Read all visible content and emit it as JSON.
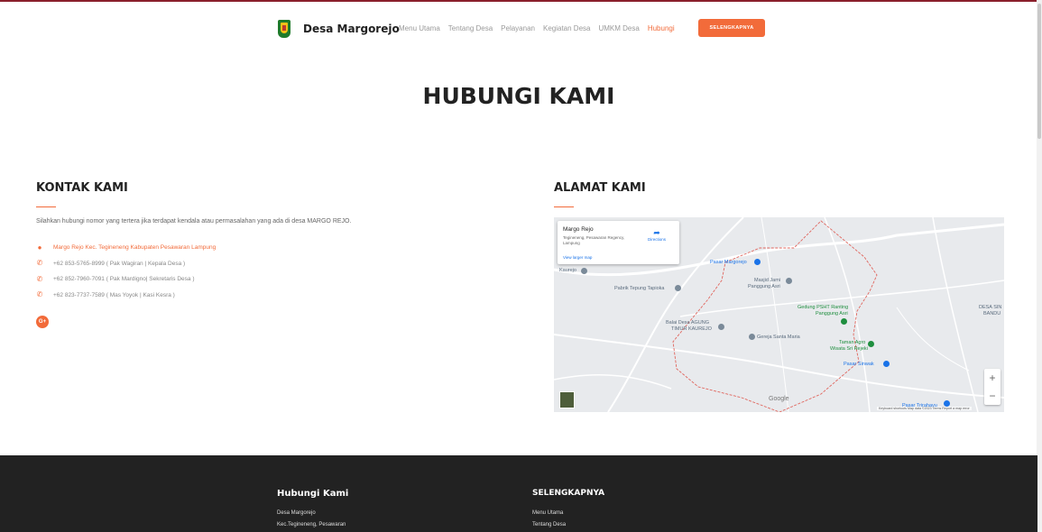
{
  "brand": {
    "name": "Desa Margorejo"
  },
  "nav": {
    "items": [
      "Menu Utama",
      "Tentang Desa",
      "Pelayanan",
      "Kegiatan Desa",
      "UMKM Desa",
      "Hubungi"
    ],
    "active": "Hubungi",
    "cta": "SELENGKAPNYA"
  },
  "hero": {
    "title": "HUBUNGI KAMI"
  },
  "contact": {
    "heading": "KONTAK KAMI",
    "intro": "Silahkan hubungi nomor yang tertera jika terdapat kendala atau permasalahan yang ada di desa MARGO REJO.",
    "address": "Margo Rejo Kec. Tegineneng Kabupaten Pesawaran Lampung",
    "phones": [
      "+62 853-5765-8999 ( Pak Wagiran | Kepala Desa )",
      "+62 852-7960-7091 ( Pak Mardigno| Sekretaris Desa )",
      "+62 823-7737-7589 ( Mas Yoyok | Kasi Kesra )"
    ],
    "social_icon": "google-plus-icon",
    "social_label": "G+"
  },
  "address_section": {
    "heading": "ALAMAT KAMI",
    "map": {
      "card_title": "Margo Rejo",
      "card_subtitle": "Tegineneng, Pesawaran Regency, Lampung",
      "directions": "Directions",
      "view_larger": "View larger map",
      "labels": {
        "pasar_margorejo": "Pasar Margorejo",
        "kaurejo": "Kaurejo",
        "pabrik": "Pabrik Tepung Tapioka",
        "masjid": "Masjid Jami",
        "panggung": "Panggung Asri",
        "gedung": "Gedung PSHT Ranting",
        "gedung2": "Panggung Asri",
        "balai": "Balai Desa AGUNG",
        "balai2": "TIMUR KAUREJO",
        "gereja": "Gereja Santa Maria",
        "taman": "Taman Agro",
        "taman2": "Wisata Sri Rejeki",
        "pasar_sinwak": "Pasar Sinwak",
        "desa_sin": "DESA SIN",
        "bandung": "BANDU",
        "pasar_trirahayu": "Pasar Trirahayu",
        "google": "Google",
        "attribution": "Keyboard shortcuts   Map data ©2023   Terms   Report a map error"
      },
      "zoom_in": "+",
      "zoom_out": "−"
    }
  },
  "footer": {
    "col1_title": "Hubungi Kami",
    "col1_lines": [
      "Desa Margorejo",
      "Kec.Tegineneng, Pesawaran"
    ],
    "col2_title": "SELENGKAPNYA",
    "col2_lines": [
      "Menu Utama",
      "Tentang Desa"
    ]
  },
  "colors": {
    "accent": "#f26b3a",
    "footer_bg": "#222222",
    "topline": "#8a1f2b"
  }
}
